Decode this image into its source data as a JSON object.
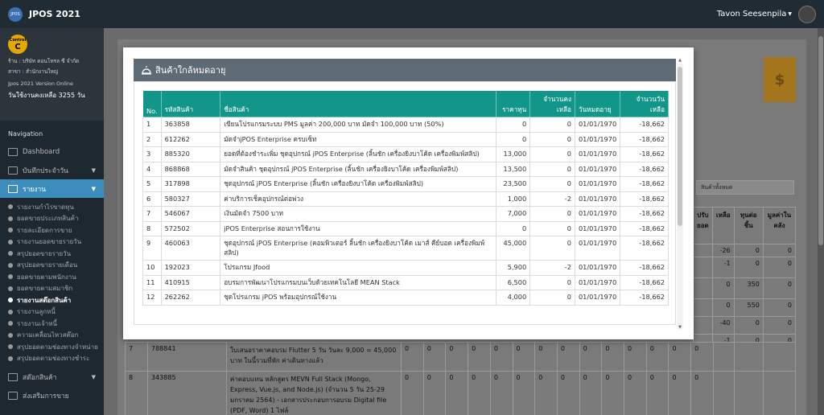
{
  "app": {
    "logo_text": "JPOS",
    "name": "JPOS 2021",
    "user_name": "Tavon Seesenpila"
  },
  "shop": {
    "badge_top": "Control",
    "badge_letter": "C",
    "shop_name": "ร้าน : บริษัท คอนโทรล ซี จำกัด",
    "branch": "สาขา : สำนักงานใหญ่",
    "version": "Jpos 2021 Version Online",
    "days_left": "วันใช้งานคงเหลือ 3255 วัน"
  },
  "nav": {
    "heading": "Navigation",
    "items": [
      {
        "label": "Dashboard"
      },
      {
        "label": "บันทึกประจำวัน"
      },
      {
        "label": "รายงาน"
      }
    ],
    "report_items": [
      "รายงานกำไรขาดทุน",
      "ยอดขายประเภทสินค้า",
      "รายละเอียดการขาย",
      "รายงานยอดขายรายวัน",
      "สรุปยอดขายรายวัน",
      "สรุปยอดขายรายเดือน",
      "ยอดขายตามพนักงาน",
      "ยอดขายตามสมาชิก",
      "รายงานสต๊อกสินค้า",
      "รายงานลูกหนี้",
      "รายงานเจ้าหนี้",
      "ความเคลื่อนไหวสต๊อก",
      "สรุปยอดตามช่องทางจำหน่าย",
      "สรุปยอดตามช่องทางชำระ"
    ],
    "bottom_items": [
      {
        "label": "สต๊อกสินค้า"
      },
      {
        "label": "ส่งเสริมการขาย"
      }
    ]
  },
  "background": {
    "dollar": "$",
    "filter_select": "สินค้าทั้งหมด",
    "headers": [
      "ปรับ ยอด",
      "เหลือ",
      "ทุนต่อ ชิ้น",
      "มูลค่าใน คลัง"
    ],
    "right_rows": [
      [
        "-26",
        "0",
        "0"
      ],
      [
        "-1",
        "0",
        "0"
      ],
      [
        "0",
        "350",
        "0"
      ],
      [
        "0",
        "550",
        "0"
      ],
      [
        "-40",
        "0",
        "0"
      ],
      [
        "-1",
        "0",
        "0"
      ]
    ],
    "rows": [
      {
        "no": "7",
        "code": "788841",
        "name": "ใบเสนอราคาคอบรม Flutter 5 วัน วันละ 9,000 = 45,000 บาท ในนี้รวมที่พัก ค่าเดินทางแล้ว"
      },
      {
        "no": "8",
        "code": "343885",
        "name": "ค่าตอบแทน หลักสูตร MEVN Full Stack (Mongo, Express, Vue.js, and Node.js) (จำนวน 5 วัน 25-29 มกราคม 2564) - เอกสารประกอบการอบรม Digital file (PDF, Word) 1 ไฟล์"
      }
    ],
    "zero": "0"
  },
  "modal": {
    "title": "สินค้าใกล้หมดอายุ",
    "columns": [
      "No.",
      "รหัสสินค้า",
      "ชื่อสินค้า",
      "ราคาทุน",
      "จำนวนคงเหลือ",
      "วันหมดอายุ",
      "จำนวนวันเหลือ"
    ],
    "rows": [
      [
        "1",
        "363858",
        "เขียนโปรแกรมระบบ PMS มูลค่า 200,000 บาท มัดจำ 100,000 บาท (50%)",
        "0",
        "0",
        "01/01/1970",
        "-18,662"
      ],
      [
        "2",
        "612262",
        "มัดจำjPOS Enterprise ครบเซ็ท",
        "0",
        "0",
        "01/01/1970",
        "-18,662"
      ],
      [
        "3",
        "885320",
        "ยอดที่ต้องชำระเพิ่ม ชุดอุปกรณ์ jPOS Enterprise (ลิ้นชัก เครื่องยิงบาโค้ด เครื่องพิมพ์สลิป)",
        "13,000",
        "0",
        "01/01/1970",
        "-18,662"
      ],
      [
        "4",
        "868868",
        "มัดจำสินค้า ชุดอุปกรณ์ jPOS Enterprise (ลิ้นชัก เครื่องยิงบาโค้ด เครื่องพิมพ์สลิป)",
        "13,500",
        "0",
        "01/01/1970",
        "-18,662"
      ],
      [
        "5",
        "317898",
        "ชุดอุปกรณ์ jPOS Enterprise (ลิ้นชัก เครื่องยิงบาโค้ด เครื่องพิมพ์สลิป)",
        "23,500",
        "0",
        "01/01/1970",
        "-18,662"
      ],
      [
        "6",
        "580327",
        "ค่าบริการเช็คอุปกรณ์ต่อพ่วง",
        "1,000",
        "-2",
        "01/01/1970",
        "-18,662"
      ],
      [
        "7",
        "546067",
        "เงินมัดจำ 7500 บาท",
        "7,000",
        "0",
        "01/01/1970",
        "-18,662"
      ],
      [
        "8",
        "572502",
        "jPOS Enterprise สอนการใช้งาน",
        "0",
        "0",
        "01/01/1970",
        "-18,662"
      ],
      [
        "9",
        "460063",
        "ชุดอุปกรณ์ jPOS Enterprise (คอมพิวเตอร์ ลิ้นชัก เครื่องยิงบาโค้ด เมาส์ คีย์บอด เครื่องพิมพ์สลิป)",
        "45,000",
        "0",
        "01/01/1970",
        "-18,662"
      ],
      [
        "10",
        "192023",
        "โปรแกรม Jfood",
        "5,900",
        "-2",
        "01/01/1970",
        "-18,662"
      ],
      [
        "11",
        "410915",
        "อบรมการพัฒนาโปรแกรมบนเว็บด้วยเทคโนโลยี MEAN Stack",
        "6,500",
        "0",
        "01/01/1970",
        "-18,662"
      ],
      [
        "12",
        "262262",
        "ชุดโปรแกรม jPOS พร้อมอุปกรณ์ใช้งาน",
        "4,000",
        "0",
        "01/01/1970",
        "-18,662"
      ]
    ]
  }
}
